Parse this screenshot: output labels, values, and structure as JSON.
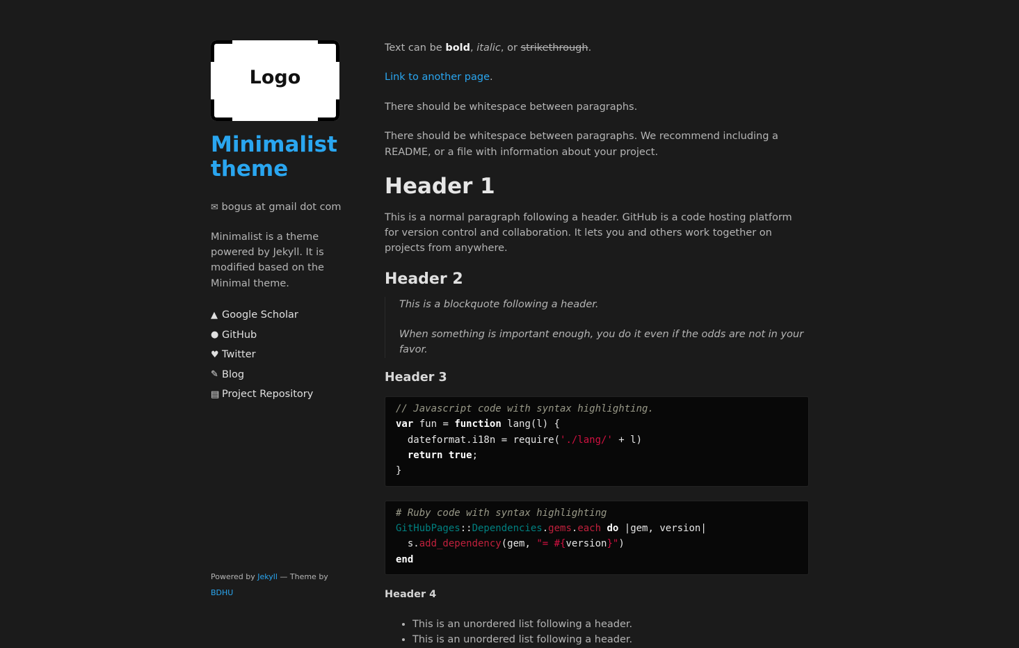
{
  "sidebar": {
    "logo_text": "Logo",
    "site_title": "Minimalist theme",
    "email": "bogus at gmail dot com",
    "description": "Minimalist is a theme powered by Jekyll. It is modified based on the Minimal theme.",
    "links": [
      {
        "icon": "graduation-cap-icon",
        "glyph": "🎓",
        "label": "Google Scholar"
      },
      {
        "icon": "github-icon",
        "glyph": "◉",
        "label": "GitHub"
      },
      {
        "icon": "twitter-icon",
        "glyph": "🐦",
        "label": "Twitter"
      },
      {
        "icon": "pencil-icon",
        "glyph": "✎",
        "label": "Blog"
      },
      {
        "icon": "archive-icon",
        "glyph": "▤",
        "label": "Project Repository"
      }
    ],
    "footer": {
      "powered_by": "Powered by",
      "jekyll": "Jekyll",
      "theme_by": "— Theme by",
      "author": "BDHU"
    }
  },
  "main": {
    "p1": {
      "pre": "Text can be",
      "bold": "bold",
      "comma1": ",",
      "italic": "italic",
      "or": ", or",
      "strike": "strikethrough",
      "end": "."
    },
    "link": {
      "text": "Link to another page",
      "end": "."
    },
    "p2": "There should be whitespace between paragraphs.",
    "p3": "There should be whitespace between paragraphs. We recommend including a README, or a file with information about your project.",
    "h1": "Header 1",
    "p4": "This is a normal paragraph following a header. GitHub is a code hosting platform for version control and collaboration. It lets you and others work together on projects from anywhere.",
    "h2": "Header 2",
    "quote": [
      "This is a blockquote following a header.",
      "When something is important enough, you do it even if the odds are not in your favor."
    ],
    "h3": "Header 3",
    "js": {
      "comment": "// Javascript code with syntax highlighting.",
      "var": "var",
      "fun": " fun = ",
      "function": "function",
      "lang": " lang(l) {",
      "l3a": "  dateformat.i18n = require(",
      "str": "'./lang/'",
      "l3b": " + l)",
      "ret_indent": "  ",
      "return": "return",
      "sp": " ",
      "true": "true",
      "semi": ";",
      "close": "}"
    },
    "rb": {
      "comment": "# Ruby code with syntax highlighting",
      "c1": "GitHubPages",
      "sep": "::",
      "c2": "Dependencies",
      "dot1": ".",
      "gems": "gems",
      "dot2": ".",
      "each": "each",
      "sp1": " ",
      "do": "do",
      "args": " |gem, version|",
      "l3a": "  s.",
      "add": "add_dependency",
      "l3b": "(gem, ",
      "s1": "\"= #{",
      "ver": "version",
      "s2": "}\"",
      "l3c": ")",
      "end": "end"
    },
    "h4": "Header 4",
    "list": [
      "This is an unordered list following a header.",
      "This is an unordered list following a header."
    ]
  }
}
